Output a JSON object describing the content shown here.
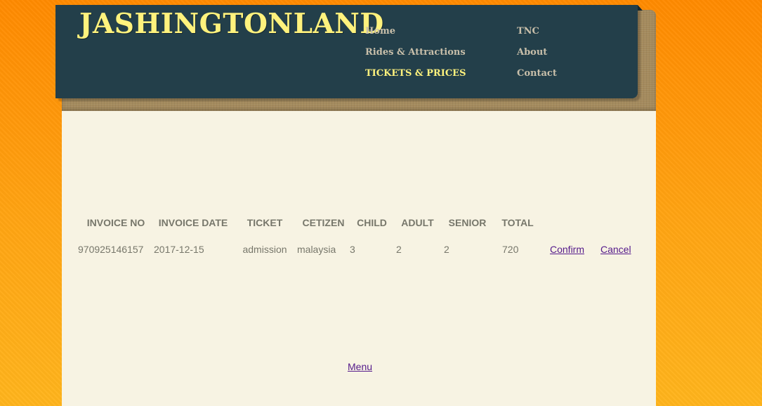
{
  "site": {
    "logo": "JASHINGTONLAND"
  },
  "nav": {
    "items": [
      {
        "label": "Home",
        "active": false
      },
      {
        "label": "Rides & Attractions",
        "active": false
      },
      {
        "label": "TICKETS & PRICES",
        "active": true
      },
      {
        "label": "TNC",
        "active": false
      },
      {
        "label": "About",
        "active": false
      },
      {
        "label": "Contact",
        "active": false
      }
    ]
  },
  "invoice": {
    "headers": [
      "INVOICE NO",
      "INVOICE DATE",
      "TICKET",
      "CETIZEN",
      "CHILD",
      "ADULT",
      "SENIOR",
      "TOTAL"
    ],
    "rows": [
      {
        "invoice_no": "970925146157",
        "invoice_date": "2017-12-15",
        "ticket": "admission",
        "citizen": "malaysia",
        "child": "3",
        "adult": "2",
        "senior": "2",
        "total": "720",
        "confirm_label": "Confirm",
        "cancel_label": "Cancel"
      }
    ]
  },
  "footer": {
    "menu_label": "Menu"
  },
  "colors": {
    "background_orange": "#ff8a00",
    "header_teal": "#233f4a",
    "logo_yellow": "#fff27d",
    "content_cream": "#f7f3e3",
    "link_purple": "#551a8b"
  }
}
